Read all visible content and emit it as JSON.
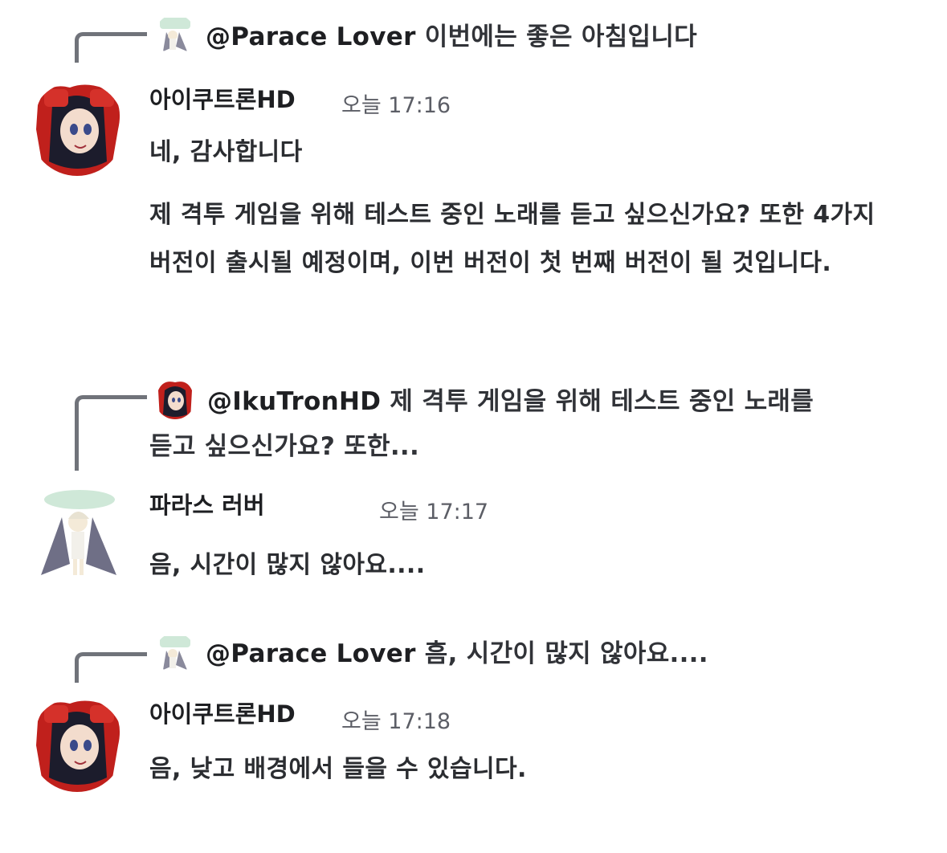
{
  "messages": [
    {
      "reply": {
        "mention": "@Parace Lover",
        "text": "이번에는 좋은 아침입니다",
        "avatar_icon": "parace-lover-avatar-icon"
      },
      "author": "아이쿠트론HD",
      "time": "오늘 17:16",
      "avatar_icon": "ikutron-avatar-icon",
      "lines": [
        "네, 감사합니다"
      ],
      "extra_lines": [
        " 제 격투 게임을 위해 테스트 중인 노래를 듣고 싶으신가요? 또한 4가지",
        "버전이 출시될 예정이며, 이번 버전이 첫 번째 버전이 될 것입니다."
      ]
    },
    {
      "reply": {
        "mention": "@IkuTronHD",
        "text_line1": "제 격투 게임을 위해 테스트 중인 노래를",
        "text_line2": "듣고 싶으신가요? 또한...",
        "avatar_icon": "ikutron-avatar-icon"
      },
      "author": "파라스 러버",
      "time": "오늘 17:17",
      "avatar_icon": "parace-lover-avatar-icon",
      "lines": [
        "음, 시간이 많지 않아요...."
      ]
    },
    {
      "reply": {
        "mention": "@Parace Lover",
        "text": "흠, 시간이 많지 않아요....",
        "avatar_icon": "parace-lover-avatar-icon"
      },
      "author": "아이쿠트론HD",
      "time": "오늘 17:18",
      "avatar_icon": "ikutron-avatar-icon",
      "lines": [
        "음, 낮고 배경에서 들을 수 있습니다."
      ]
    }
  ],
  "colors": {
    "background": "#ffffff",
    "reply_line": "#70737a",
    "text": "#2b2d31",
    "timestamp": "#5c5e66"
  }
}
